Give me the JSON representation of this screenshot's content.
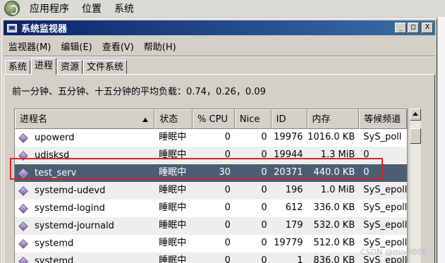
{
  "top_panel": {
    "items": [
      "应用程序",
      "位置",
      "系统"
    ]
  },
  "window": {
    "title": "系统监视器",
    "buttons": [
      "_",
      "□",
      "X"
    ]
  },
  "menubar": {
    "items": [
      "监视器(M)",
      "编辑(E)",
      "查看(V)",
      "帮助(H)"
    ]
  },
  "tabs": [
    "系统",
    "进程",
    "资源",
    "文件系统"
  ],
  "active_tab": "进程",
  "load_average": "前一分钟、五分钟、十五分钟的平均负载：0.74，0.26，0.09",
  "table": {
    "columns": [
      "进程名",
      "状态",
      "% CPU",
      "Nice",
      "ID",
      "内存",
      "等候频道"
    ],
    "rows": [
      {
        "name": "upowerd",
        "state": "睡眠中",
        "cpu": "0",
        "nice": "0",
        "id": "19976",
        "mem": "1016.0 KB",
        "wait": "SyS_poll"
      },
      {
        "name": "udisksd",
        "state": "睡眠中",
        "cpu": "0",
        "nice": "0",
        "id": "19944",
        "mem": "1.3 MiB",
        "wait": "0"
      },
      {
        "name": "test_serv",
        "state": "睡眠中",
        "cpu": "30",
        "nice": "0",
        "id": "20371",
        "mem": "440.0 KB",
        "wait": "0"
      },
      {
        "name": "systemd-udevd",
        "state": "睡眠中",
        "cpu": "0",
        "nice": "0",
        "id": "196",
        "mem": "1.0 MiB",
        "wait": "SyS_epoll_w"
      },
      {
        "name": "systemd-logind",
        "state": "睡眠中",
        "cpu": "0",
        "nice": "0",
        "id": "612",
        "mem": "336.0 KB",
        "wait": "SyS_epoll_w"
      },
      {
        "name": "systemd-journald",
        "state": "睡眠中",
        "cpu": "0",
        "nice": "0",
        "id": "179",
        "mem": "532.0 KB",
        "wait": "SyS_epoll_w"
      },
      {
        "name": "systemd",
        "state": "睡眠中",
        "cpu": "0",
        "nice": "0",
        "id": "19779",
        "mem": "512.0 KB",
        "wait": "SyS_epoll_w"
      },
      {
        "name": "systemd",
        "state": "睡眠中",
        "cpu": "0",
        "nice": "0",
        "id": "1",
        "mem": "836.0 KB",
        "wait": "SyS_epoll_w"
      }
    ]
  },
  "watermark": "CSDN @modl000",
  "colors": {
    "selected_row": "#4b5e73",
    "highlight_box": "#d8232a",
    "titlebar": "#0a246a"
  }
}
